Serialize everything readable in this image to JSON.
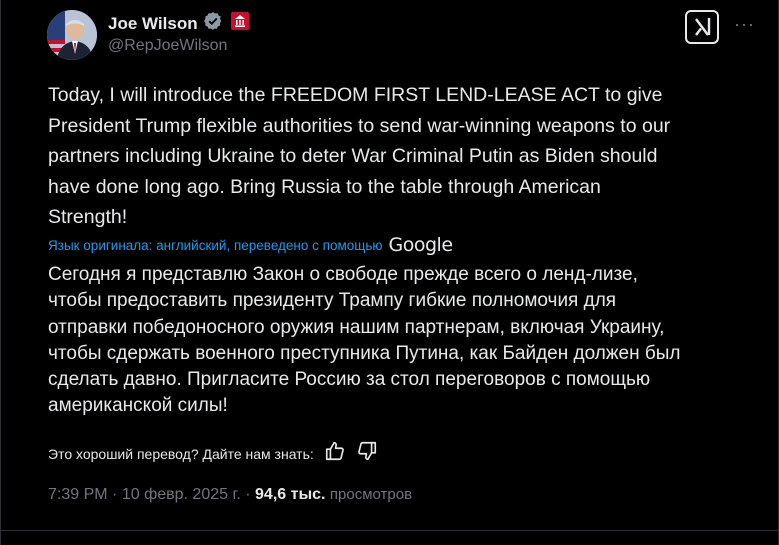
{
  "author": {
    "name": "Joe Wilson",
    "handle": "@RepJoeWilson"
  },
  "tweet": {
    "text": "Today, I will introduce the FREEDOM FIRST LEND-LEASE ACT to give\nPresident Trump flexible authorities to send war-winning weapons to our\npartners including Ukraine to deter War Criminal Putin as Biden should\nhave done long ago. Bring Russia to the table through American\nStrength!",
    "translation_note": "Язык оригинала: английский, переведено с помощью",
    "translation_provider": "Google",
    "translated_text": "Сегодня я представлю Закон о свободе прежде всего о ленд-лизе,\nчтобы предоставить президенту Трампу гибкие полномочия для\nотправки победоносного оружия нашим партнерам, включая Украину,\nчтобы сдержать военного преступника Путина, как Байден должен был\nсделать давно. Пригласите Россию за стол переговоров с помощью\nамериканской силы!",
    "feedback_question": "Это хороший перевод? Дайте нам знать:"
  },
  "meta": {
    "time": "7:39 PM",
    "separator": "·",
    "date": "10 февр. 2025 г.",
    "views": "94,6 тыс.",
    "views_label": "просмотров"
  },
  "icons": {
    "verified": "verified-badge-icon",
    "affiliation": "us-house-badge-icon",
    "grok": "grok-icon",
    "more": "more-icon",
    "thumbs_up": "thumbs-up-icon",
    "thumbs_down": "thumbs-down-icon"
  },
  "colors": {
    "background": "#000000",
    "text": "#e7e9ea",
    "secondary": "#71767b",
    "link": "#1d9bf0",
    "affiliation_red": "#c8102e"
  }
}
